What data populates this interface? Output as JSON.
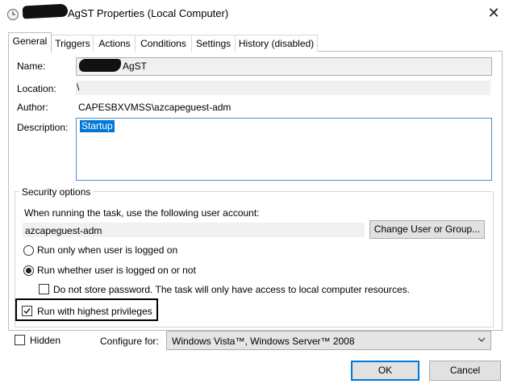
{
  "window": {
    "title": "AgST Properties (Local Computer)",
    "close_glyph": "✕"
  },
  "tabs": [
    {
      "label": "General",
      "active": true
    },
    {
      "label": "Triggers"
    },
    {
      "label": "Actions"
    },
    {
      "label": "Conditions"
    },
    {
      "label": "Settings"
    },
    {
      "label": "History (disabled)"
    }
  ],
  "general": {
    "name_label": "Name:",
    "name_value": "AgST",
    "location_label": "Location:",
    "location_value": "\\",
    "author_label": "Author:",
    "author_value": "CAPESBXVMSS\\azcapeguest-adm",
    "description_label": "Description:",
    "description_value": "Startup"
  },
  "security": {
    "legend": "Security options",
    "account_prompt": "When running the task, use the following user account:",
    "account_value": "azcapeguest-adm",
    "change_button": "Change User or Group...",
    "radio_logged_on": "Run only when user is logged on",
    "radio_whether": "Run whether user is logged on or not",
    "radio_selected": "whether",
    "no_store_password": "Do not store password.  The task will only have access to local computer resources.",
    "no_store_checked": false,
    "highest_privileges": "Run with highest privileges",
    "highest_checked": true
  },
  "footer": {
    "hidden_label": "Hidden",
    "hidden_checked": false,
    "configure_label": "Configure for:",
    "configure_value": "Windows Vista™, Windows Server™ 2008",
    "ok_button": "OK",
    "cancel_button": "Cancel"
  },
  "colors": {
    "accent": "#0078d7",
    "button_face": "#e1e1e1",
    "readonly_field": "#f0f0f0"
  },
  "icons": [
    "task-scheduler-icon",
    "close-icon",
    "chevron-down-icon",
    "checkmark-icon"
  ]
}
